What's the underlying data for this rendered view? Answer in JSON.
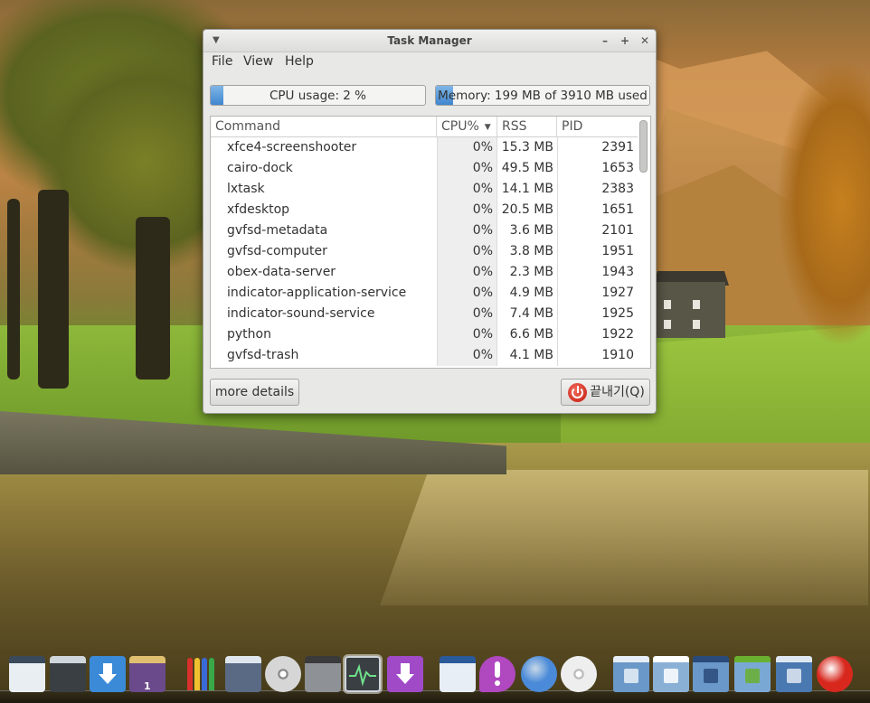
{
  "window": {
    "title": "Task Manager",
    "menu": [
      "File",
      "View",
      "Help"
    ],
    "cpu_meter": {
      "label": "CPU usage: 2 %",
      "fraction": 0.02
    },
    "memory_meter": {
      "label": "Memory: 199 MB of 3910 MB used",
      "fraction": 0.05
    },
    "table": {
      "columns": [
        "Command",
        "CPU%",
        "RSS",
        "PID"
      ],
      "sorted_column": "CPU%",
      "rows": [
        {
          "command": "xfce4-screenshooter",
          "cpu": "0%",
          "rss": "15.3 MB",
          "pid": "2391"
        },
        {
          "command": "cairo-dock",
          "cpu": "0%",
          "rss": "49.5 MB",
          "pid": "1653"
        },
        {
          "command": "lxtask",
          "cpu": "0%",
          "rss": "14.1 MB",
          "pid": "2383"
        },
        {
          "command": "xfdesktop",
          "cpu": "0%",
          "rss": "20.5 MB",
          "pid": "1651"
        },
        {
          "command": "gvfsd-metadata",
          "cpu": "0%",
          "rss": "3.6 MB",
          "pid": "2101"
        },
        {
          "command": "gvfsd-computer",
          "cpu": "0%",
          "rss": "3.8 MB",
          "pid": "1951"
        },
        {
          "command": "obex-data-server",
          "cpu": "0%",
          "rss": "2.3 MB",
          "pid": "1943"
        },
        {
          "command": "indicator-application-service",
          "cpu": "0%",
          "rss": "4.9 MB",
          "pid": "1927"
        },
        {
          "command": "indicator-sound-service",
          "cpu": "0%",
          "rss": "7.4 MB",
          "pid": "1925"
        },
        {
          "command": "python",
          "cpu": "0%",
          "rss": "6.6 MB",
          "pid": "1922"
        },
        {
          "command": "gvfsd-trash",
          "cpu": "0%",
          "rss": "4.1 MB",
          "pid": "1910"
        }
      ]
    },
    "more_details_label": "more details",
    "quit_label": "끝내기(Q)"
  },
  "dock": {
    "items": [
      {
        "name": "text-editor-icon",
        "color": "#e9eef2",
        "accent": "#3a4a5a"
      },
      {
        "name": "monitor-icon",
        "color": "#3a3f44",
        "accent": "#cfd6dc"
      },
      {
        "name": "download-icon",
        "color": "#3a8ad8",
        "accent": "#ffffff"
      },
      {
        "name": "image-viewer-icon",
        "color": "#6a4a8a",
        "accent": "#e0c070",
        "badge": "1"
      },
      {
        "name": "graphics-pencils-icon",
        "color": "#d8302a",
        "accent": "#f0c030"
      },
      {
        "name": "notes-icon",
        "color": "#5a6a84",
        "accent": "#dfe6ee"
      },
      {
        "name": "cd-player-icon",
        "color": "#d6d6d6",
        "accent": "#8a8a8a"
      },
      {
        "name": "camera-icon",
        "color": "#8e9296",
        "accent": "#3a3a3a"
      },
      {
        "name": "system-monitor-icon",
        "color": "#1f2a24",
        "accent": "#6fe08a",
        "active": true
      },
      {
        "name": "package-install-icon",
        "color": "#a04ac8",
        "accent": "#ffffff"
      },
      {
        "name": "scanner-icon",
        "color": "#e8eef6",
        "accent": "#2a5a9a"
      },
      {
        "name": "chat-notify-icon",
        "color": "#b048c0",
        "accent": "#ffffff"
      },
      {
        "name": "chromium-icon",
        "color": "#4a8ad8",
        "accent": "#c8d8e8"
      },
      {
        "name": "brightness-icon",
        "color": "#eeeeee",
        "accent": "#bbbbbb"
      },
      {
        "name": "home-folder-icon",
        "color": "#6a98c8",
        "accent": "#e8eef6"
      },
      {
        "name": "documents-folder-icon",
        "color": "#8ab0d6",
        "accent": "#ffffff"
      },
      {
        "name": "backup-folder-icon",
        "color": "#6a98c8",
        "accent": "#2a4a7a"
      },
      {
        "name": "downloads-folder-icon",
        "color": "#7aa8d4",
        "accent": "#6ab030"
      },
      {
        "name": "desktop-folder-icon",
        "color": "#4a78b0",
        "accent": "#dfe8f2"
      },
      {
        "name": "shutdown-icon",
        "color": "#d8281e",
        "accent": "#ffffff"
      }
    ]
  }
}
